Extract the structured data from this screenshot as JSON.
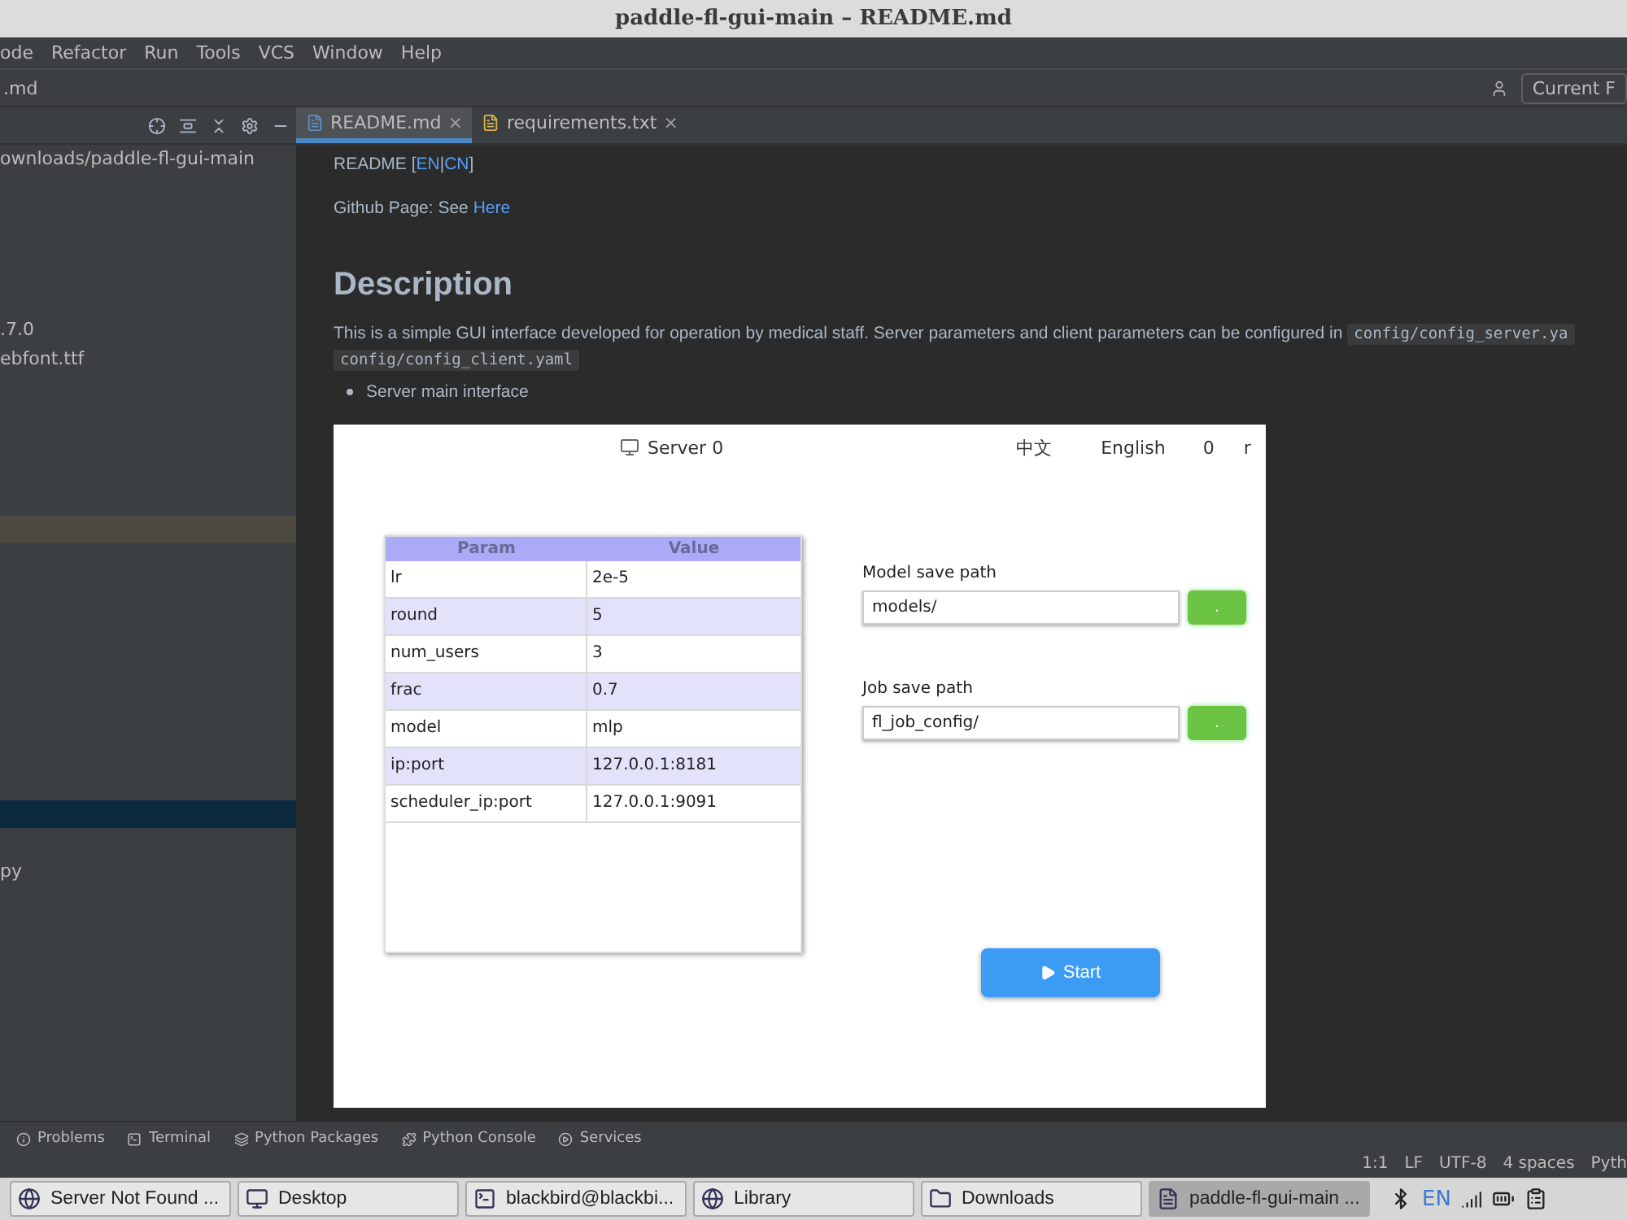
{
  "window": {
    "title": "paddle-fl-gui-main – README.md"
  },
  "menu": [
    "ode",
    "Refactor",
    "Run",
    "Tools",
    "VCS",
    "Window",
    "Help"
  ],
  "navbar": {
    "path": ".md",
    "run_config": "Current F"
  },
  "project_panel": {
    "items": [
      {
        "label": "ownloads/paddle-fl-gui-main"
      },
      {
        "label": ".7.0"
      },
      {
        "label": "ebfont.ttf"
      },
      {
        "label": "py"
      }
    ]
  },
  "editor_tabs": [
    {
      "label": "README.md",
      "selected": true,
      "close": "×"
    },
    {
      "label": "requirements.txt",
      "selected": false,
      "close": "×"
    }
  ],
  "readme": {
    "lang_line": {
      "text": "README [",
      "links": [
        "EN",
        "CN"
      ],
      "sep": "|",
      "end": "]"
    },
    "github_line": {
      "text": "Github Page: See ",
      "link": "Here"
    },
    "heading": "Description",
    "paragraph": "This is a simple GUI interface developed for operation by medical staff. Server parameters and client parameters can be configured in",
    "code_1": "config/config_server.ya",
    "code_2": "config/config_client.yaml",
    "bullet": "Server main interface",
    "app": {
      "title": "Server 0",
      "lang_options": [
        "中文",
        "English"
      ],
      "counter": "0",
      "extra": "r",
      "table": {
        "columns": [
          "Param",
          "Value"
        ],
        "rows": [
          [
            "lr",
            "2e-5"
          ],
          [
            "round",
            "5"
          ],
          [
            "num_users",
            "3"
          ],
          [
            "frac",
            "0.7"
          ],
          [
            "model",
            "mlp"
          ],
          [
            "ip:port",
            "127.0.0.1:8181"
          ],
          [
            "scheduler_ip:port",
            "127.0.0.1:9091"
          ]
        ]
      },
      "fields": [
        {
          "label": "Model save path",
          "value": "models/",
          "button": "."
        },
        {
          "label": "Job save path",
          "value": "fl_job_config/",
          "button": "."
        }
      ],
      "start": "Start"
    }
  },
  "tool_windows": [
    "Problems",
    "Terminal",
    "Python Packages",
    "Python Console",
    "Services"
  ],
  "status_bar": [
    "1:1",
    "LF",
    "UTF-8",
    "4 spaces",
    "Pyth"
  ],
  "taskbar": {
    "items": [
      {
        "label": "Server Not Found ...",
        "selected": false
      },
      {
        "label": "Desktop",
        "selected": false
      },
      {
        "label": "blackbird@blackbi...",
        "selected": false
      },
      {
        "label": "Library",
        "selected": false
      },
      {
        "label": "Downloads",
        "selected": false
      },
      {
        "label": "paddle-fl-gui-main ...",
        "selected": true
      }
    ],
    "keyboard": "EN"
  }
}
